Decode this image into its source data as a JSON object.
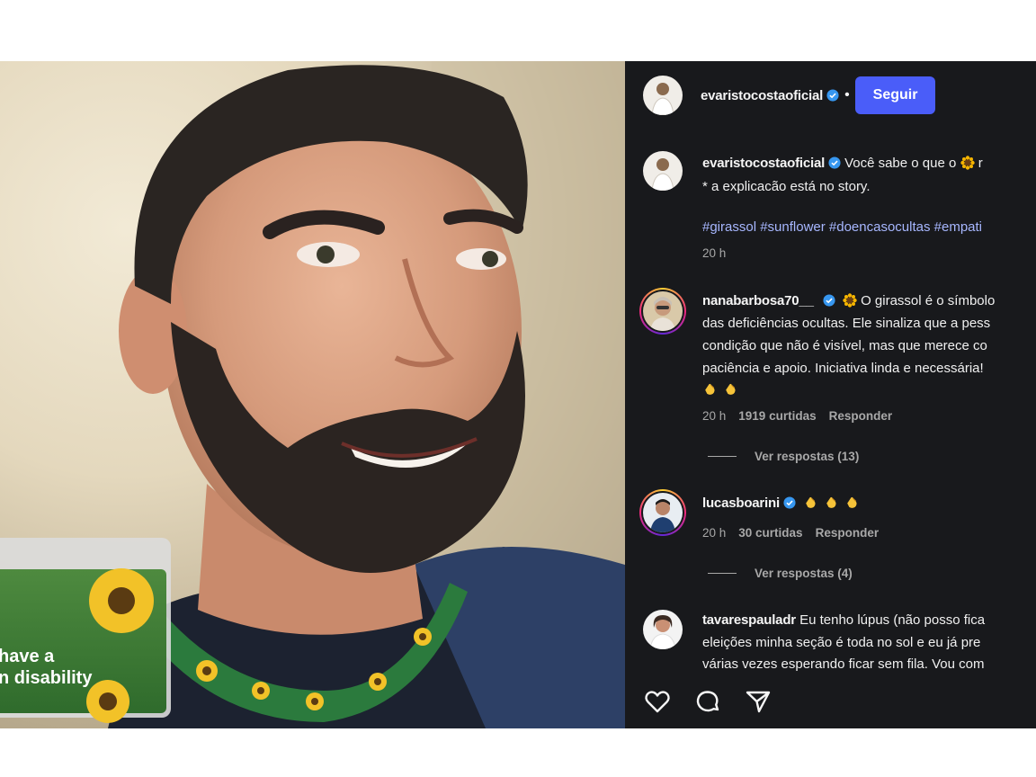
{
  "post_author": {
    "username": "evaristocostaoficial",
    "separator": "•",
    "follow_label": "Seguir"
  },
  "photo": {
    "badge_text_line1": "have a",
    "badge_text_line2": "n disability"
  },
  "caption": {
    "username": "evaristocostaoficial",
    "text_line1": "Você sabe o que o",
    "text_line1_tail": "r",
    "text_line2": "* a explicacão está no story.",
    "hashtags": "#girassol #sunflower #doencasocultas #empati",
    "time": "20 h"
  },
  "comments": [
    {
      "username": "nanabarbosa70__",
      "lines": [
        "O girassol é o símbolo",
        "das deficiências ocultas. Ele sinaliza que a pess",
        "condição que não é visível, mas que merece co",
        "paciência e apoio. Iniciativa linda e necessária!"
      ],
      "time": "20 h",
      "likes": "1919 curtidas",
      "reply": "Responder",
      "view_replies": "Ver respostas (13)"
    },
    {
      "username": "lucasboarini",
      "time": "20 h",
      "likes": "30 curtidas",
      "reply": "Responder",
      "view_replies": "Ver respostas (4)"
    },
    {
      "username": "tavarespauladr",
      "lines": [
        "Eu tenho lúpus (não posso fica",
        "eleições minha seção é toda no sol e eu já pre",
        "várias vezes esperando ficar sem fila. Vou com"
      ]
    }
  ],
  "icons": {
    "like": "heart-icon",
    "comment": "comment-icon",
    "share": "share-icon",
    "verified": "verified-badge-icon",
    "sunflower": "sunflower-emoji-icon",
    "clap": "clapping-hands-emoji-icon"
  },
  "colors": {
    "panel_bg": "#18191c",
    "follow_button": "#4a5df9",
    "hashtag": "#a7b7ff",
    "verified": "#3797f0"
  }
}
